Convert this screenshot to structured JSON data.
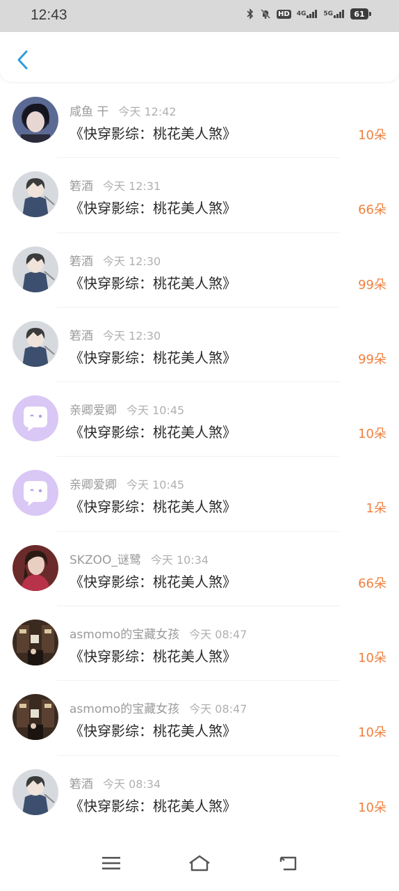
{
  "status": {
    "time": "12:43",
    "hd_label": "HD",
    "net1": "4G",
    "net2": "5G",
    "battery": "61"
  },
  "header": {
    "back_icon": "chevron-left-icon"
  },
  "colors": {
    "accent": "#2d9cdb",
    "amount": "#f07f3c"
  },
  "records": [
    {
      "name": "咸鱼 干",
      "time": "今天 12:42",
      "title": "《快穿影综：桃花美人煞》",
      "amount": "10朵",
      "avatar": "photo-girl"
    },
    {
      "name": "箬酒",
      "time": "今天 12:31",
      "title": "《快穿影综：桃花美人煞》",
      "amount": "66朵",
      "avatar": "anime-boy"
    },
    {
      "name": "箬酒",
      "time": "今天 12:30",
      "title": "《快穿影综：桃花美人煞》",
      "amount": "99朵",
      "avatar": "anime-boy"
    },
    {
      "name": "箬酒",
      "time": "今天 12:30",
      "title": "《快穿影综：桃花美人煞》",
      "amount": "99朵",
      "avatar": "anime-boy"
    },
    {
      "name": "亲卿爱卿",
      "time": "今天 10:45",
      "title": "《快穿影综：桃花美人煞》",
      "amount": "10朵",
      "avatar": "default-chat"
    },
    {
      "name": "亲卿爱卿",
      "time": "今天 10:45",
      "title": "《快穿影综：桃花美人煞》",
      "amount": "1朵",
      "avatar": "default-chat"
    },
    {
      "name": "SKZOO_谜鹭",
      "time": "今天 10:34",
      "title": "《快穿影综：桃花美人煞》",
      "amount": "66朵",
      "avatar": "photo-woman"
    },
    {
      "name": "asmomo的宝藏女孩",
      "time": "今天 08:47",
      "title": "《快穿影综：桃花美人煞》",
      "amount": "10朵",
      "avatar": "photo-street"
    },
    {
      "name": "asmomo的宝藏女孩",
      "time": "今天 08:47",
      "title": "《快穿影综：桃花美人煞》",
      "amount": "10朵",
      "avatar": "photo-street"
    },
    {
      "name": "箬酒",
      "time": "今天 08:34",
      "title": "《快穿影综：桃花美人煞》",
      "amount": "10朵",
      "avatar": "anime-boy"
    }
  ],
  "nav": {
    "menu_icon": "menu-icon",
    "home_icon": "home-icon",
    "back_icon": "back-icon"
  }
}
